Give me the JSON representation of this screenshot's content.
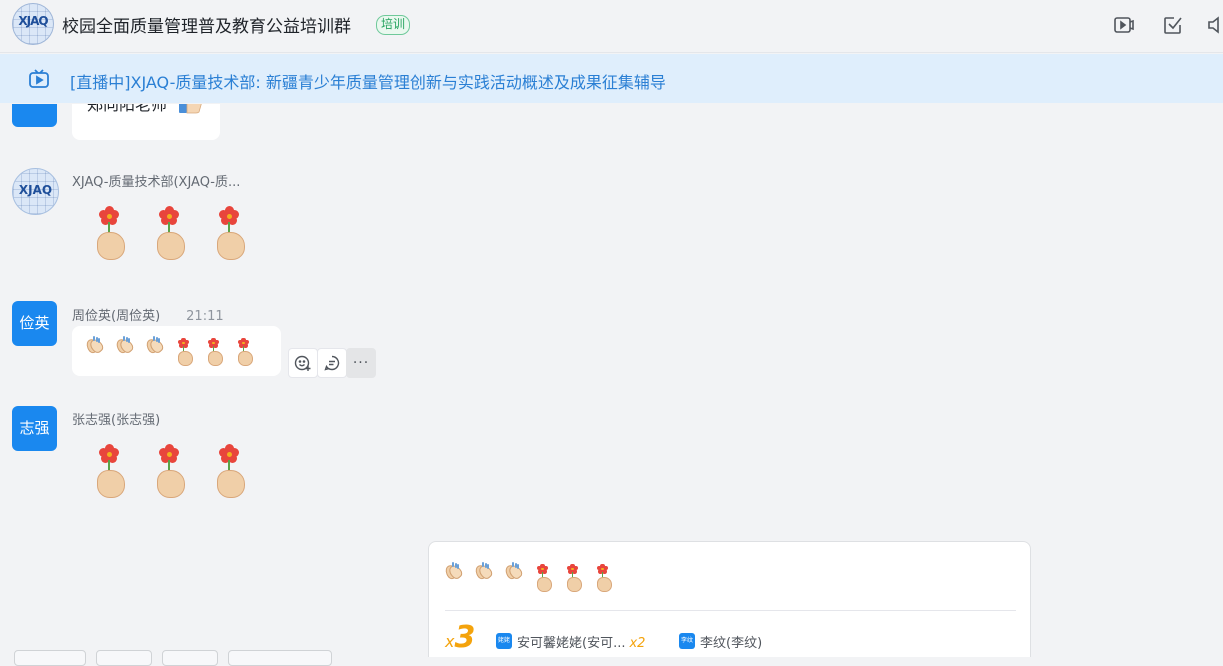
{
  "header": {
    "logo_text": "XJAQ",
    "title": "校园全面质量管理普及教育公益培训群",
    "tag": "培训",
    "icons": [
      "video-icon",
      "checkbox-icon",
      "speaker-icon"
    ]
  },
  "live": {
    "text": "[直播中]XJAQ-质量技术部: 新疆青少年质量管理创新与实践活动概述及成果征集辅导"
  },
  "messages": [
    {
      "text": "郑向阳老师"
    },
    {
      "avatar_text": "XJAQ",
      "sender": "XJAQ-质量技术部(XJAQ-质...",
      "emoji": [
        "flower-hand",
        "flower-hand",
        "flower-hand"
      ]
    },
    {
      "avatar_text": "俭英",
      "sender": "周俭英(周俭英)",
      "time": "21:11",
      "emoji": [
        "clap",
        "clap",
        "clap",
        "flower-hand",
        "flower-hand",
        "flower-hand"
      ],
      "actions": [
        "add-reaction-icon",
        "reply-icon",
        "more-icon"
      ],
      "more_label": "···"
    },
    {
      "avatar_text": "志强",
      "sender": "张志强(张志强)",
      "emoji": [
        "flower-hand",
        "flower-hand",
        "flower-hand"
      ]
    }
  ],
  "reply_card": {
    "emoji": [
      "clap",
      "clap",
      "clap",
      "flower-hand",
      "flower-hand",
      "flower-hand"
    ],
    "multiplier_prefix": "x",
    "multiplier": "3",
    "responders": [
      {
        "avatar_text": "姥姥",
        "name": "安可馨姥姥(安可...",
        "count": "x2"
      },
      {
        "avatar_text": "李纹",
        "name": "李纹(李纹)",
        "count": ""
      }
    ]
  },
  "colors": {
    "accent": "#1a88ef",
    "live_bg": "#dfeefc",
    "live_text": "#2a7fd4",
    "tag_green": "#26a35f",
    "multiplier": "#f4a30c"
  }
}
